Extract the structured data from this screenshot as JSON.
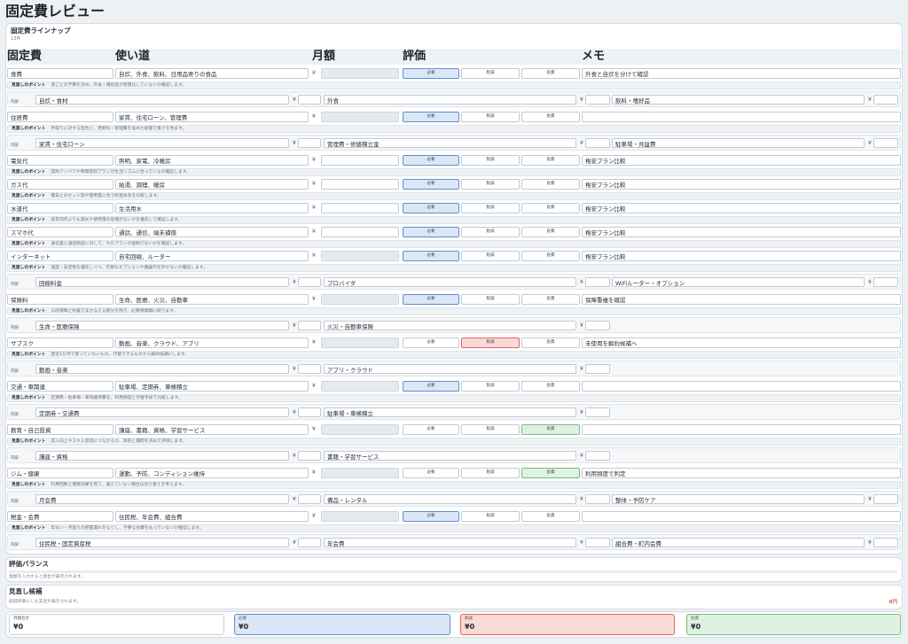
{
  "page": {
    "title": "固定費レビュー"
  },
  "lineup": {
    "title": "固定費ラインナップ",
    "count": "13件"
  },
  "columns": {
    "name": "固定費",
    "usage": "使い道",
    "amount": "月額",
    "rating": "評価",
    "memo": "メモ"
  },
  "labels": {
    "currency": "¥",
    "point": "見直しのポイント",
    "breakdown": "内訳"
  },
  "rating_options": [
    "必要",
    "削減",
    "投資"
  ],
  "rating_colors": [
    {
      "bg": "#dbe7f6",
      "border": "#5f8fd0"
    },
    {
      "bg": "#f9dad6",
      "border": "#e2665d"
    },
    {
      "bg": "#dff1e2",
      "border": "#72bd83"
    }
  ],
  "items": [
    {
      "name": "食費",
      "usage": "自炊、外食、飲料、日用品寄りの食品",
      "amount": "",
      "rating_index": 0,
      "memo": "外食と自炊を分けて確認",
      "point": "週ごとの予算を決め、外食・嗜好品が習慣化していないか確認します。",
      "breakdown": [
        {
          "label": "自炊・食材",
          "amount": ""
        },
        {
          "label": "外食",
          "amount": ""
        },
        {
          "label": "飲料・嗜好品",
          "amount": ""
        }
      ]
    },
    {
      "name": "住居費",
      "usage": "家賃、住宅ローン、管理費",
      "amount": "",
      "rating_index": 0,
      "memo": "",
      "point": "手取りに対する割合と、更新料・管理費を含めた総額で重さを見ます。",
      "breakdown": [
        {
          "label": "家賃・住宅ローン",
          "amount": ""
        },
        {
          "label": "管理費・修繕積立金",
          "amount": ""
        },
        {
          "label": "駐車場・共益費",
          "amount": ""
        }
      ]
    },
    {
      "name": "電気代",
      "usage": "照明、家電、冷暖房",
      "amount": "",
      "rating_index": 0,
      "memo": "格安プラン比較",
      "point": "契約アンペアや時間帯別プランが生活リズムに合っているか確認します。",
      "breakdown": []
    },
    {
      "name": "ガス代",
      "usage": "給湯、調理、暖房",
      "amount": "",
      "rating_index": 0,
      "memo": "格安プラン比較",
      "point": "電気とのセット割や使用量に合う料金体系を比較します。",
      "breakdown": []
    },
    {
      "name": "水道代",
      "usage": "生活用水",
      "amount": "",
      "rating_index": 0,
      "memo": "格安プラン比較",
      "point": "前年同月よりも漏水や使用量の急増がないかを優先して確認します。",
      "breakdown": []
    },
    {
      "name": "スマホ代",
      "usage": "通話、通信、端末補償",
      "amount": "",
      "rating_index": 0,
      "memo": "格安プラン比較",
      "point": "通信量と通話頻度に対して、今のプランが過剰でないかを確認します。",
      "breakdown": []
    },
    {
      "name": "インターネット",
      "usage": "自宅回線、ルーター",
      "amount": "",
      "rating_index": 0,
      "memo": "格安プラン比較",
      "point": "速度・安定性を優先しつつ、不要なオプションや機器代を外せないか確認します。",
      "breakdown": [
        {
          "label": "回線料金",
          "amount": ""
        },
        {
          "label": "プロバイダ",
          "amount": ""
        },
        {
          "label": "WiFiルーター・オプション",
          "amount": ""
        }
      ]
    },
    {
      "name": "保険料",
      "usage": "生命、医療、火災、自動車",
      "amount": "",
      "rating_index": 0,
      "memo": "保障重複を確認",
      "point": "公的保障と貯蓄でまかなえる部分を除き、必要保障額に絞ります。",
      "breakdown": [
        {
          "label": "生命・医療保険",
          "amount": ""
        },
        {
          "label": "火災・自動車保険",
          "amount": ""
        }
      ]
    },
    {
      "name": "サブスク",
      "usage": "動画、音楽、クラウド、アプリ",
      "amount": "",
      "rating_index": 1,
      "memo": "未使用を解約候補へ",
      "point": "直近1か月で使っていないもの、代替できるものから解約候補にします。",
      "breakdown": [
        {
          "label": "動画・音楽",
          "amount": ""
        },
        {
          "label": "アプリ・クラウド",
          "amount": ""
        }
      ]
    },
    {
      "name": "交通・車関連",
      "usage": "駐車場、定期券、車検積立",
      "amount": "",
      "rating_index": 0,
      "memo": "",
      "point": "定期券・駐車場・車両維持費を、利用頻度と代替手段で比較します。",
      "breakdown": [
        {
          "label": "定期券・交通費",
          "amount": ""
        },
        {
          "label": "駐車場・車検積立",
          "amount": ""
        }
      ]
    },
    {
      "name": "教育・自己投資",
      "usage": "講座、書籍、資格、学習サービス",
      "amount": "",
      "rating_index": 2,
      "memo": "",
      "point": "収入向上やスキル習得につながるか、目的と期間を決めて評価します。",
      "breakdown": [
        {
          "label": "講座・資格",
          "amount": ""
        },
        {
          "label": "書籍・学習サービス",
          "amount": ""
        }
      ]
    },
    {
      "name": "ジム・健康",
      "usage": "運動、予防、コンディション維持",
      "amount": "",
      "rating_index": 2,
      "memo": "利用頻度で判定",
      "point": "利用回数と健康効果を見て、通えていない場合は切り替えを考えます。",
      "breakdown": [
        {
          "label": "月会費",
          "amount": ""
        },
        {
          "label": "備品・レンタル",
          "amount": ""
        },
        {
          "label": "整体・予防ケア",
          "amount": ""
        }
      ]
    },
    {
      "name": "税金・会費",
      "usage": "住民税、年会費、組合費",
      "amount": "",
      "rating_index": 0,
      "memo": "",
      "point": "年払い・月割りの把握漏れをなくし、不要な会費を払っていないか確認します。",
      "breakdown": [
        {
          "label": "住民税・固定資産税",
          "amount": ""
        },
        {
          "label": "年会費",
          "amount": ""
        },
        {
          "label": "組合費・町内会費",
          "amount": ""
        }
      ]
    }
  ],
  "balance": {
    "title": "評価バランス",
    "note": "金額を入力すると割合が表示されます。"
  },
  "candidates": {
    "title": "見直し候補",
    "note": "削減評価にした支出が表示されます。",
    "total": "0円",
    "total_color": "#e05a4f"
  },
  "summary": [
    {
      "label": "月額合計",
      "value": "¥0"
    },
    {
      "label": "必要",
      "value": "¥0"
    },
    {
      "label": "削減",
      "value": "¥0"
    },
    {
      "label": "投資",
      "value": "¥0"
    }
  ]
}
